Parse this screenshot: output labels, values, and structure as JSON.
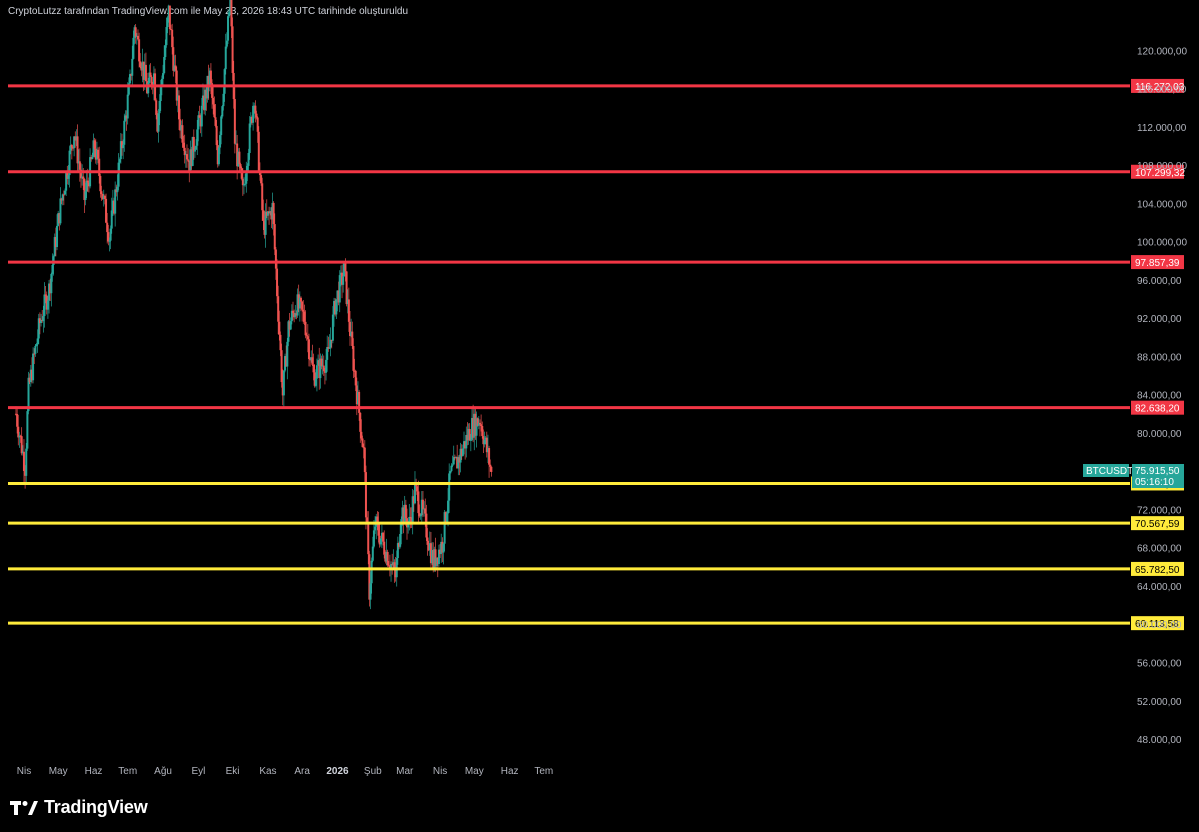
{
  "header": {
    "caption": "CryptoLutzz tarafından TradingView.com ile May 23, 2026 18:43 UTC tarihinde oluşturuldu"
  },
  "brand": {
    "name": "TradingView",
    "icon": "tradingview-logo-icon"
  },
  "colors": {
    "background": "#000000",
    "up": "#26a69a",
    "down": "#ef5350",
    "resistance": "#f23645",
    "support": "#ffeb3b",
    "price_badge": "#26a69a",
    "axis_text": "#b2b5be"
  },
  "chart_data": {
    "type": "candlestick",
    "symbol": "BTCUSDT",
    "last_price": "75.915,50",
    "countdown": "05:16:10",
    "y_axis": {
      "ticks": [
        48000,
        52000,
        56000,
        60000,
        64000,
        68000,
        72000,
        76000,
        80000,
        84000,
        88000,
        92000,
        96000,
        100000,
        104000,
        108000,
        112000,
        116000,
        120000
      ],
      "tick_labels": [
        "48.000,00",
        "52.000,00",
        "56.000,00",
        "60.000,00",
        "64.000,00",
        "68.000,00",
        "72.000,00",
        "76.000,00",
        "80.000,00",
        "84.000,00",
        "88.000,00",
        "92.000,00",
        "96.000,00",
        "100.000,00",
        "104.000,00",
        "108.000,00",
        "112.000,00",
        "116.000,00",
        "120.000,00"
      ],
      "range": [
        45600,
        124000
      ]
    },
    "x_axis": {
      "labels": [
        "Nis",
        "May",
        "Haz",
        "Tem",
        "Ağu",
        "Eyl",
        "Eki",
        "Kas",
        "Ara",
        "2026",
        "Şub",
        "Mar",
        "Nis",
        "May",
        "Haz",
        "Tem"
      ],
      "bold": [
        "2026"
      ]
    },
    "horizontal_levels": [
      {
        "value": 116272.03,
        "label": "116.272,03",
        "kind": "resistance"
      },
      {
        "value": 107299.32,
        "label": "107.299,32",
        "kind": "resistance"
      },
      {
        "value": 97857.39,
        "label": "97.857,39",
        "kind": "resistance"
      },
      {
        "value": 82638.2,
        "label": "82.638,20",
        "kind": "resistance"
      },
      {
        "value": 74716.26,
        "label": "74.716,26",
        "kind": "support"
      },
      {
        "value": 70567.59,
        "label": "70.567,59",
        "kind": "support"
      },
      {
        "value": 65782.5,
        "label": "65.782,50",
        "kind": "support"
      },
      {
        "value": 60113.58,
        "label": "60.113,58",
        "kind": "support"
      }
    ],
    "price_path": [
      [
        "2025-04-01",
        82000
      ],
      [
        "2025-04-09",
        76500
      ],
      [
        "2025-04-12",
        84500
      ],
      [
        "2025-04-22",
        91500
      ],
      [
        "2025-04-30",
        95000
      ],
      [
        "2025-05-09",
        103000
      ],
      [
        "2025-05-22",
        111500
      ],
      [
        "2025-05-31",
        104500
      ],
      [
        "2025-06-09",
        110000
      ],
      [
        "2025-06-22",
        100500
      ],
      [
        "2025-06-30",
        107500
      ],
      [
        "2025-07-10",
        116500
      ],
      [
        "2025-07-14",
        122500
      ],
      [
        "2025-07-25",
        116000
      ],
      [
        "2025-07-31",
        117500
      ],
      [
        "2025-08-03",
        112500
      ],
      [
        "2025-08-13",
        124000
      ],
      [
        "2025-08-22",
        113000
      ],
      [
        "2025-08-31",
        108200
      ],
      [
        "2025-09-10",
        113000
      ],
      [
        "2025-09-18",
        117200
      ],
      [
        "2025-09-25",
        109000
      ],
      [
        "2025-10-06",
        125500
      ],
      [
        "2025-10-10",
        110500
      ],
      [
        "2025-10-17",
        105000
      ],
      [
        "2025-10-27",
        115500
      ],
      [
        "2025-11-04",
        101500
      ],
      [
        "2025-11-12",
        103500
      ],
      [
        "2025-11-21",
        84000
      ],
      [
        "2025-11-26",
        91000
      ],
      [
        "2025-12-03",
        93500
      ],
      [
        "2025-12-10",
        92000
      ],
      [
        "2025-12-18",
        86000
      ],
      [
        "2025-12-31",
        88000
      ],
      [
        "2026-01-06",
        93500
      ],
      [
        "2026-01-14",
        97000
      ],
      [
        "2026-01-20",
        89500
      ],
      [
        "2026-01-31",
        78000
      ],
      [
        "2026-02-05",
        63500
      ],
      [
        "2026-02-10",
        70500
      ],
      [
        "2026-02-20",
        67500
      ],
      [
        "2026-02-28",
        65000
      ],
      [
        "2026-03-05",
        72000
      ],
      [
        "2026-03-12",
        70500
      ],
      [
        "2026-03-17",
        74000
      ],
      [
        "2026-03-25",
        71000
      ],
      [
        "2026-04-02",
        66500
      ],
      [
        "2026-04-10",
        68500
      ],
      [
        "2026-04-17",
        75500
      ],
      [
        "2026-04-25",
        77500
      ],
      [
        "2026-05-05",
        80500
      ],
      [
        "2026-05-13",
        81500
      ],
      [
        "2026-05-23",
        75915.5
      ]
    ]
  }
}
